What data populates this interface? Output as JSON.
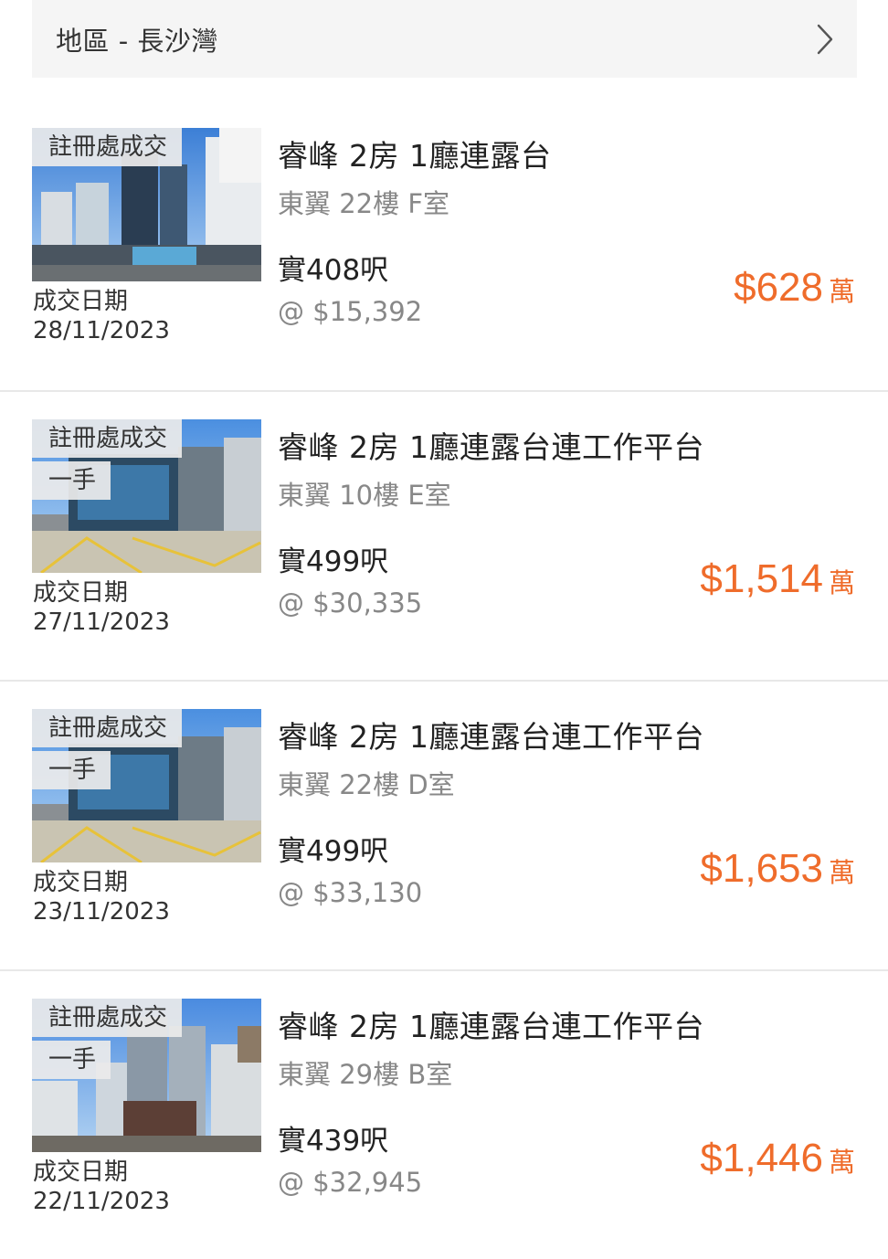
{
  "filter": {
    "region_label": "地區 - 長沙灣"
  },
  "colors": {
    "accent": "#ef6c2b",
    "muted": "#888888",
    "tag_bg": "#ebebeb",
    "bar_bg": "#f5f5f5"
  },
  "icons": {
    "chevron": "chevron-right-icon"
  },
  "transactions": [
    {
      "tag1": "註冊處成交",
      "tag2": "",
      "date_label": "成交日期",
      "date": "28/11/2023",
      "title": "睿峰 2房 1廳連露台",
      "unit": "東翼 22樓 F室",
      "area": "實408呎",
      "price_per_sqft": "@ $15,392",
      "price": "$628",
      "price_unit": "萬"
    },
    {
      "tag1": "註冊處成交",
      "tag2": "一手",
      "date_label": "成交日期",
      "date": "27/11/2023",
      "title": "睿峰 2房 1廳連露台連工作平台",
      "unit": "東翼 10樓 E室",
      "area": "實499呎",
      "price_per_sqft": "@ $30,335",
      "price": "$1,514",
      "price_unit": "萬"
    },
    {
      "tag1": "註冊處成交",
      "tag2": "一手",
      "date_label": "成交日期",
      "date": "23/11/2023",
      "title": "睿峰 2房 1廳連露台連工作平台",
      "unit": "東翼 22樓 D室",
      "area": "實499呎",
      "price_per_sqft": "@ $33,130",
      "price": "$1,653",
      "price_unit": "萬"
    },
    {
      "tag1": "註冊處成交",
      "tag2": "一手",
      "date_label": "成交日期",
      "date": "22/11/2023",
      "title": "睿峰 2房 1廳連露台連工作平台",
      "unit": "東翼 29樓 B室",
      "area": "實439呎",
      "price_per_sqft": "@ $32,945",
      "price": "$1,446",
      "price_unit": "萬"
    }
  ]
}
